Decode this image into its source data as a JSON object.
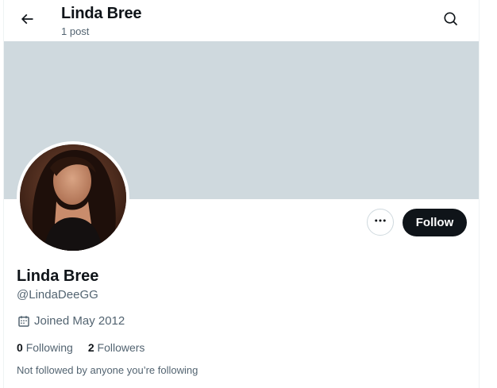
{
  "header": {
    "title": "Linda Bree",
    "post_count": "1 post",
    "back_icon": "arrow-left-icon",
    "search_icon": "search-icon"
  },
  "profile": {
    "name": "Linda Bree",
    "handle": "@LindaDeeGG",
    "joined": "Joined May 2012",
    "following_count": "0",
    "following_label": "Following",
    "followers_count": "2",
    "followers_label": "Followers",
    "not_followed_note": "Not followed by anyone you’re following"
  },
  "actions": {
    "more_icon": "more-horizontal-icon",
    "follow_label": "Follow"
  },
  "colors": {
    "banner": "#cfd9de",
    "primary_text": "#0f1419",
    "secondary_text": "#536471",
    "follow_button_bg": "#0f1419"
  }
}
